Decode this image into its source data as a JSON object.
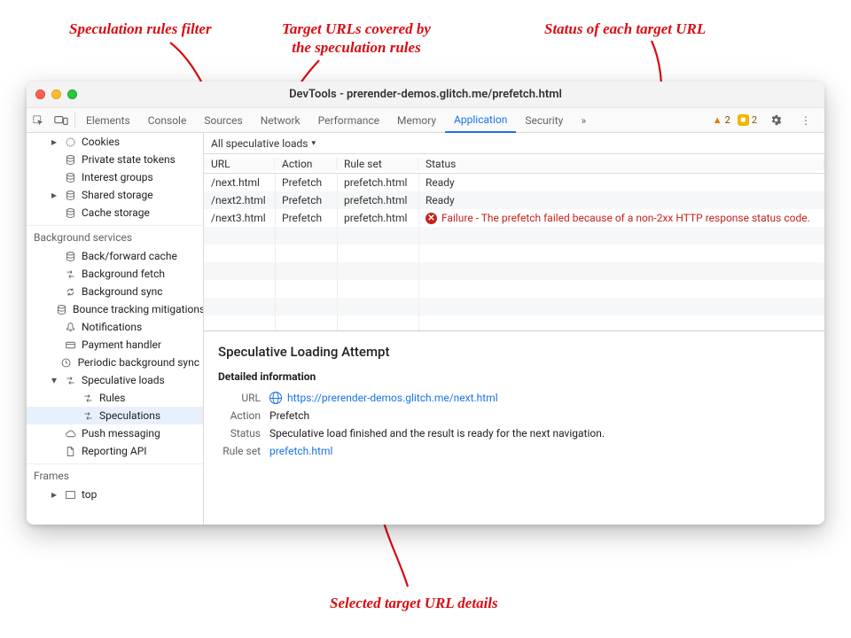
{
  "annotations": {
    "filter": "Speculation rules filter",
    "targets": "Target URLs covered by\nthe speculation rules",
    "status": "Status of each target URL",
    "details": "Selected target URL details"
  },
  "window": {
    "title": "DevTools - prerender-demos.glitch.me/prefetch.html"
  },
  "tabs": {
    "items": [
      "Elements",
      "Console",
      "Sources",
      "Network",
      "Performance",
      "Memory",
      "Application",
      "Security"
    ],
    "active": "Application",
    "warn_count": "2",
    "issue_count": "2"
  },
  "sidebar": {
    "groups": [
      {
        "header": null,
        "items": [
          {
            "label": "Cookies",
            "icon": "circle-arrow",
            "twisty": "▸"
          },
          {
            "label": "Private state tokens",
            "icon": "db"
          },
          {
            "label": "Interest groups",
            "icon": "db"
          },
          {
            "label": "Shared storage",
            "icon": "db",
            "twisty": "▸"
          },
          {
            "label": "Cache storage",
            "icon": "db"
          }
        ]
      },
      {
        "header": "Background services",
        "items": [
          {
            "label": "Back/forward cache",
            "icon": "db"
          },
          {
            "label": "Background fetch",
            "icon": "arrows"
          },
          {
            "label": "Background sync",
            "icon": "sync"
          },
          {
            "label": "Bounce tracking mitigations",
            "icon": "db"
          },
          {
            "label": "Notifications",
            "icon": "bell"
          },
          {
            "label": "Payment handler",
            "icon": "card"
          },
          {
            "label": "Periodic background sync",
            "icon": "clock"
          },
          {
            "label": "Speculative loads",
            "icon": "arrows",
            "twisty": "▾"
          },
          {
            "label": "Rules",
            "icon": "arrows",
            "indent": 2
          },
          {
            "label": "Speculations",
            "icon": "arrows",
            "indent": 2,
            "selected": true
          },
          {
            "label": "Push messaging",
            "icon": "cloud"
          },
          {
            "label": "Reporting API",
            "icon": "doc"
          }
        ]
      },
      {
        "header": "Frames",
        "items": [
          {
            "label": "top",
            "icon": "frame",
            "twisty": "▸"
          }
        ]
      }
    ]
  },
  "filter_label": "All speculative loads",
  "table": {
    "headers": [
      "URL",
      "Action",
      "Rule set",
      "Status"
    ],
    "rows": [
      {
        "url": "/next.html",
        "action": "Prefetch",
        "ruleset": "prefetch.html",
        "status": "Ready",
        "fail": false
      },
      {
        "url": "/next2.html",
        "action": "Prefetch",
        "ruleset": "prefetch.html",
        "status": "Ready",
        "fail": false
      },
      {
        "url": "/next3.html",
        "action": "Prefetch",
        "ruleset": "prefetch.html",
        "status": "Failure - The prefetch failed because of a non-2xx HTTP response status code.",
        "fail": true
      }
    ]
  },
  "detail": {
    "heading": "Speculative Loading Attempt",
    "subheading": "Detailed information",
    "url_label": "URL",
    "url": "https://prerender-demos.glitch.me/next.html",
    "action_label": "Action",
    "action": "Prefetch",
    "status_label": "Status",
    "status": "Speculative load finished and the result is ready for the next navigation.",
    "ruleset_label": "Rule set",
    "ruleset": "prefetch.html"
  }
}
